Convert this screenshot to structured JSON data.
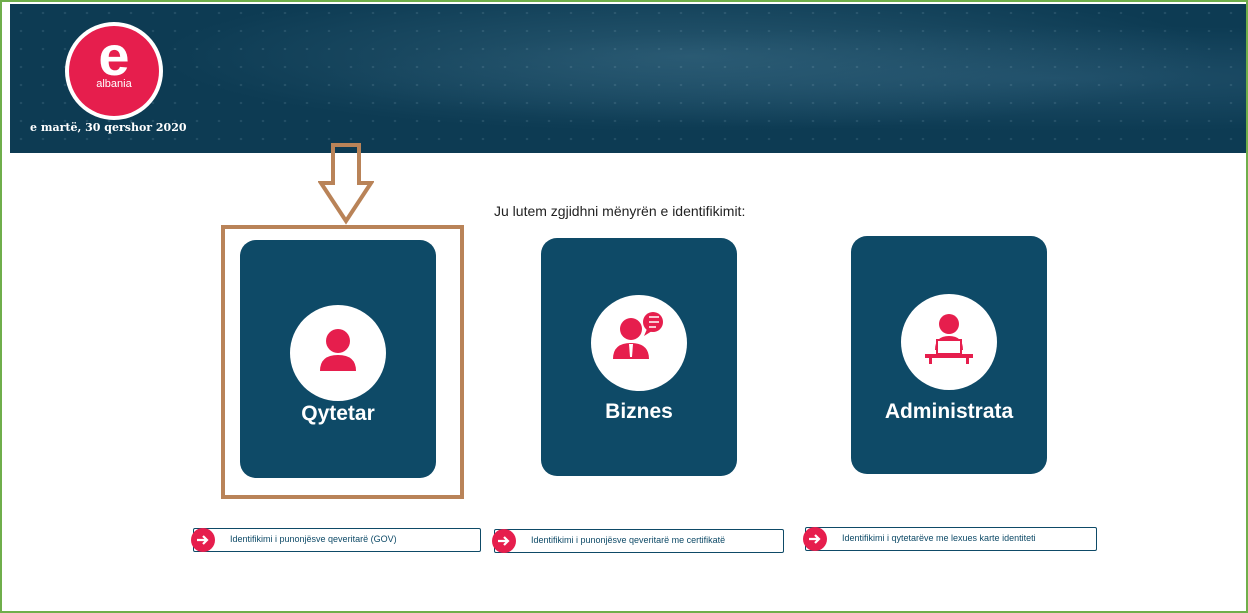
{
  "header": {
    "logo_letter": "e",
    "logo_subtitle": "albania",
    "date": "e martë, 30 qershor 2020"
  },
  "main": {
    "prompt": "Ju lutem zgjidhni mënyrën e identifikimit:",
    "cards": [
      {
        "label": "Qytetar",
        "icon": "citizen-icon"
      },
      {
        "label": "Biznes",
        "icon": "business-icon"
      },
      {
        "label": "Administrata",
        "icon": "administration-icon"
      }
    ],
    "links": [
      {
        "label": "Identifikimi i punonjësve qeveritarë (GOV)",
        "icon": "login-arrow-icon"
      },
      {
        "label": "Identifikimi i punonjësve qeveritarë me certifikatë",
        "icon": "login-arrow-icon"
      },
      {
        "label": "Identifikimi i qytetarëve me lexues karte identiteti",
        "icon": "login-arrow-icon"
      }
    ]
  },
  "colors": {
    "header_bg": "#0d3b53",
    "card_bg": "#0e4a67",
    "accent": "#e61e4d",
    "highlight_border": "#b98358",
    "frame_border": "#6fae4b"
  }
}
